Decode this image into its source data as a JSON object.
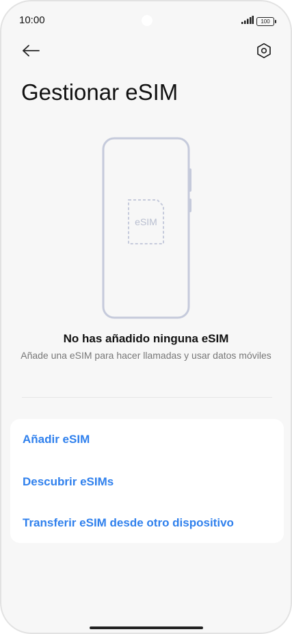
{
  "status_bar": {
    "time": "10:00",
    "battery": "100"
  },
  "header": {
    "back_icon": "arrow-left-icon",
    "settings_icon": "hexagon-settings-icon",
    "title": "Gestionar eSIM"
  },
  "illustration": {
    "sim_label": "eSIM"
  },
  "empty_state": {
    "title": "No has añadido ninguna eSIM",
    "subtitle": "Añade una eSIM para hacer llamadas y usar datos móviles"
  },
  "actions": [
    {
      "label": "Añadir eSIM"
    },
    {
      "label": "Descubrir eSIMs"
    },
    {
      "label": "Transferir eSIM desde otro dispositivo"
    }
  ],
  "colors": {
    "accent": "#2f80ed",
    "background": "#f7f7f7",
    "card": "#ffffff",
    "illustration_stroke": "#c5cadb"
  }
}
